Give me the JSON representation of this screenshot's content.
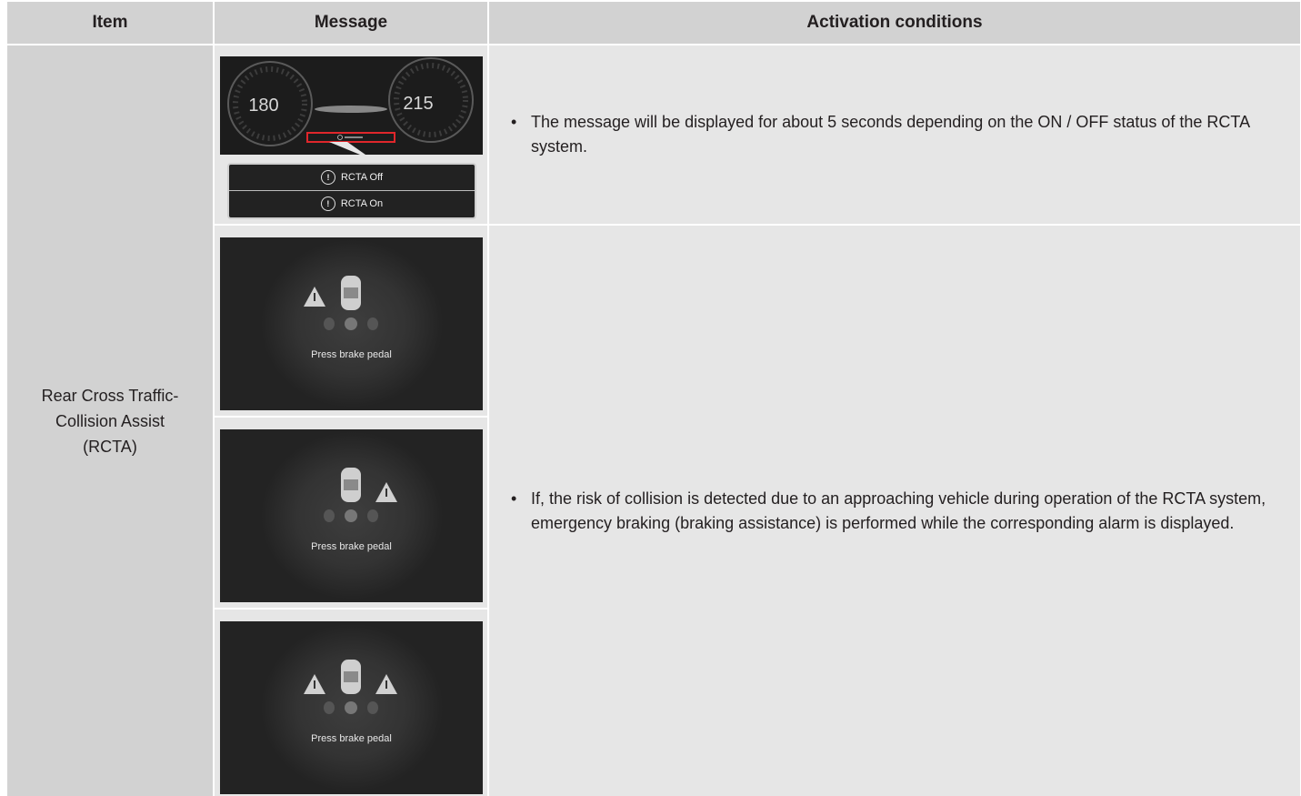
{
  "table": {
    "headers": {
      "item": "Item",
      "message": "Message",
      "conditions": "Activation conditions"
    },
    "item_name_lines": [
      "Rear Cross Traffic-",
      "Collision Assist",
      "(RCTA)"
    ],
    "row1": {
      "dash_speed_left": "180",
      "dash_speed_right": "215",
      "popup_lines": [
        "RCTA Off",
        "RCTA On"
      ],
      "condition": "The message will be displayed for about 5 seconds depending on the ON / OFF status of the RCTA system."
    },
    "row2": {
      "screens": [
        {
          "text": "Press brake pedal",
          "warning_side": "left"
        },
        {
          "text": "Press brake pedal",
          "warning_side": "right"
        },
        {
          "text": "Press brake pedal",
          "warning_side": "both"
        }
      ],
      "condition": "If, the risk of collision is detected due to an approaching vehicle during operation of the RCTA system, emergency braking (braking assistance) is performed while the corresponding alarm is displayed."
    }
  },
  "colors": {
    "header_bg": "#d2d2d2",
    "cell_bg": "#e6e6e6",
    "screen_bg": "#232323",
    "highlight": "#e0262b"
  },
  "icons": [
    "warning-triangle-icon",
    "car-top-view-icon",
    "exclamation-circle-icon"
  ]
}
